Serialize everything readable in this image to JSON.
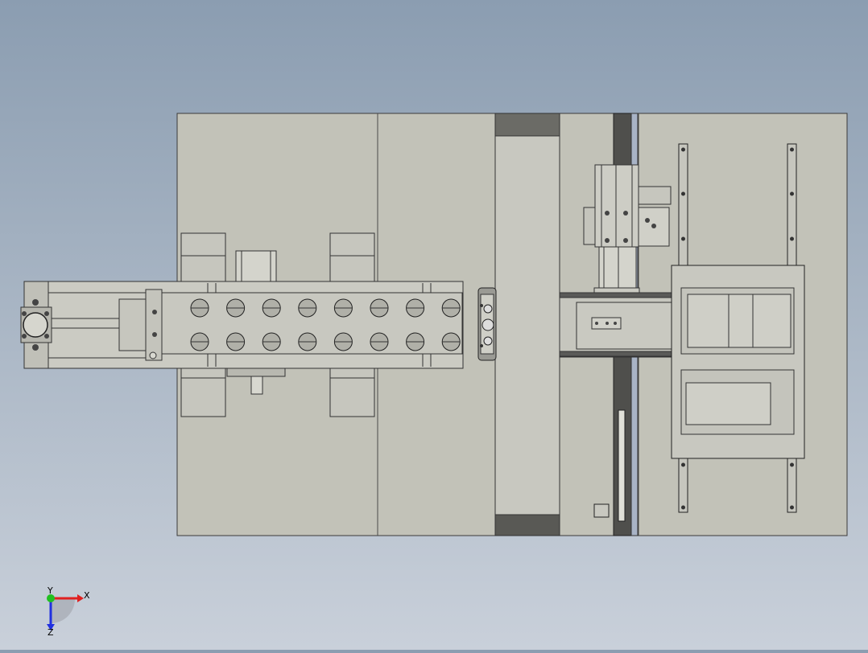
{
  "viewport": {
    "background_top": "#8b9db1",
    "background_bottom": "#c9d0da"
  },
  "colors": {
    "plate": "#c2c2b8",
    "plate_edge": "#3a3a3a",
    "metal_light": "#d0d0c8",
    "metal_dark": "#5a5a58",
    "rail_dark": "#4a4a4a",
    "rail_blue": "#a8b3c6",
    "hole": "#b0b0a8"
  },
  "triad": {
    "x_label": "X",
    "y_label": "Y",
    "z_label": "Z",
    "x_color": "#e02020",
    "y_color": "#20c020",
    "z_color": "#2030e0",
    "icon": "coordinate-triad-icon"
  },
  "model": {
    "description_icon": "cad-assembly-top-view",
    "tray_hole_rows": 2,
    "tray_hole_columns": 8
  }
}
